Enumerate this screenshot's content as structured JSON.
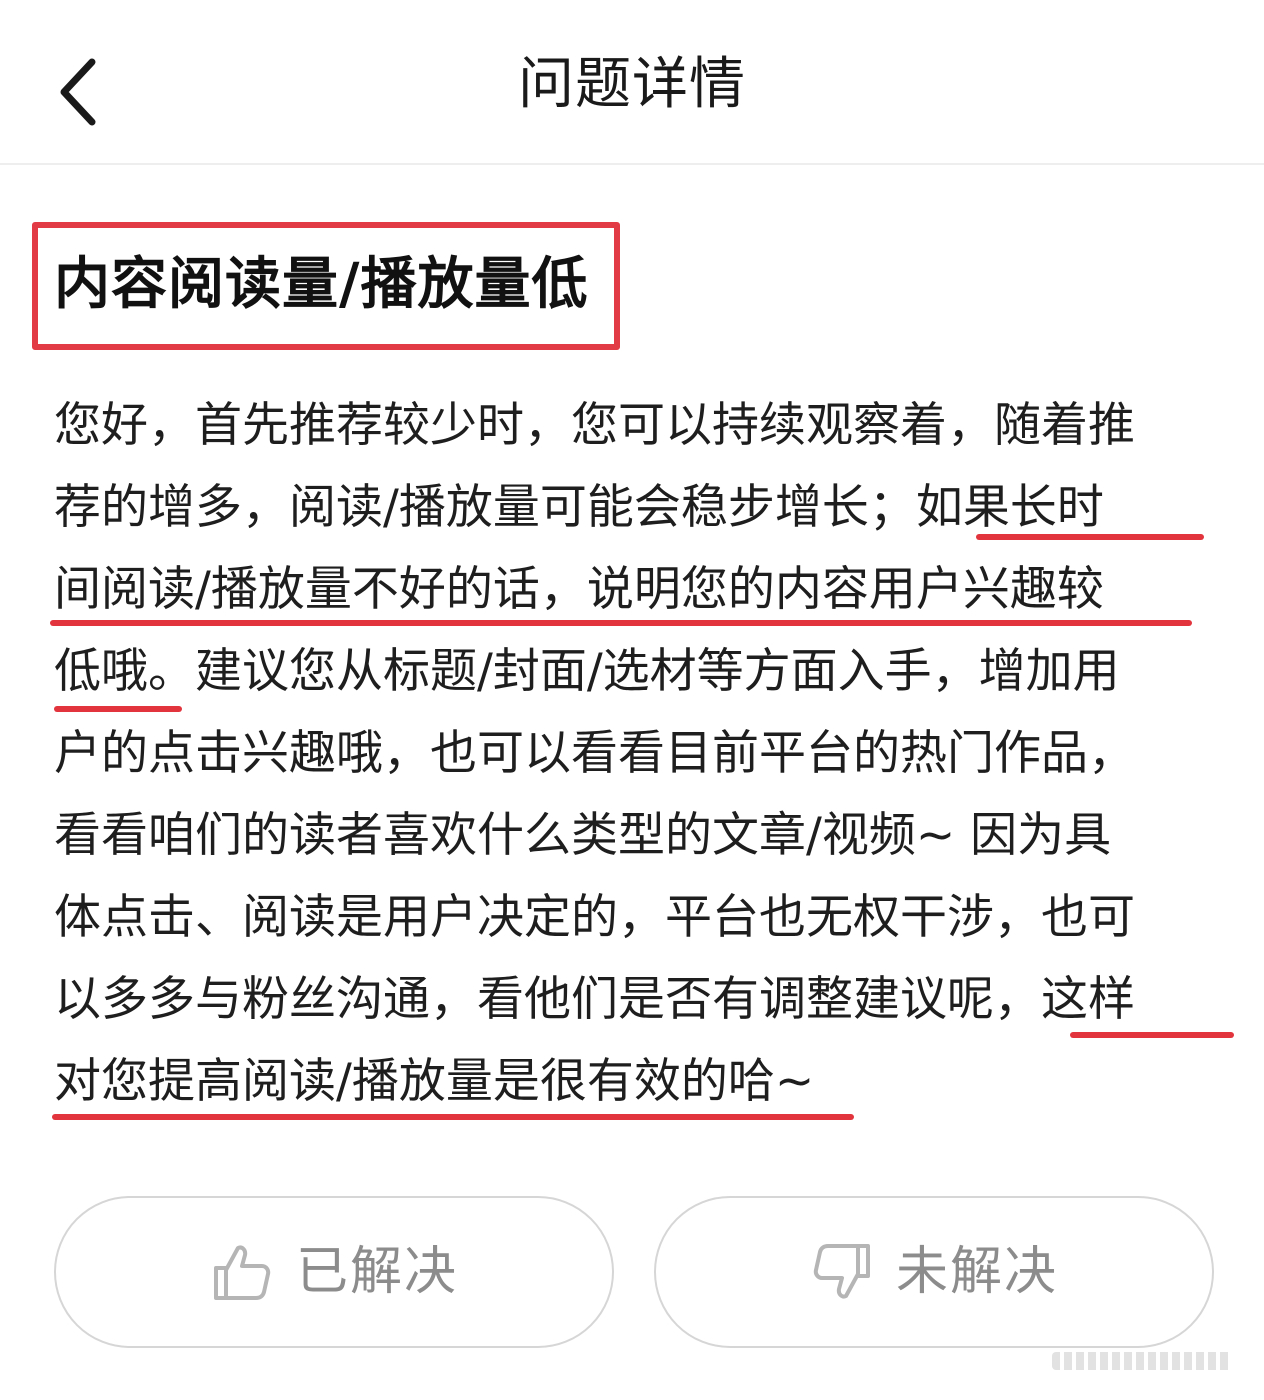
{
  "header": {
    "title": "问题详情",
    "back_icon": "chevron-left-icon"
  },
  "question": {
    "title": "内容阅读量/播放量低",
    "highlight_color": "#e23b46"
  },
  "answer": {
    "lines": [
      "您好，首先推荐较少时，您可以持续观察着，随着推",
      "荐的增多，阅读/播放量可能会稳步增长；如果长时",
      "间阅读/播放量不好的话，说明您的内容用户兴趣较",
      "低哦。建议您从标题/封面/选材等方面入手，增加用",
      "户的点击兴趣哦，也可以看看目前平台的热门作品，",
      "看看咱们的读者喜欢什么类型的文章/视频~ 因为具",
      "体点击、阅读是用户决定的，平台也无权干涉，也可",
      "以多多与粉丝沟通，看他们是否有调整建议呢，这样",
      "对您提高阅读/播放量是很有效的哈~"
    ],
    "underline_color": "#e2343d"
  },
  "feedback": {
    "resolved_label": "已解决",
    "resolved_icon": "thumbs-up-icon",
    "unresolved_label": "未解决",
    "unresolved_icon": "thumbs-down-icon"
  }
}
